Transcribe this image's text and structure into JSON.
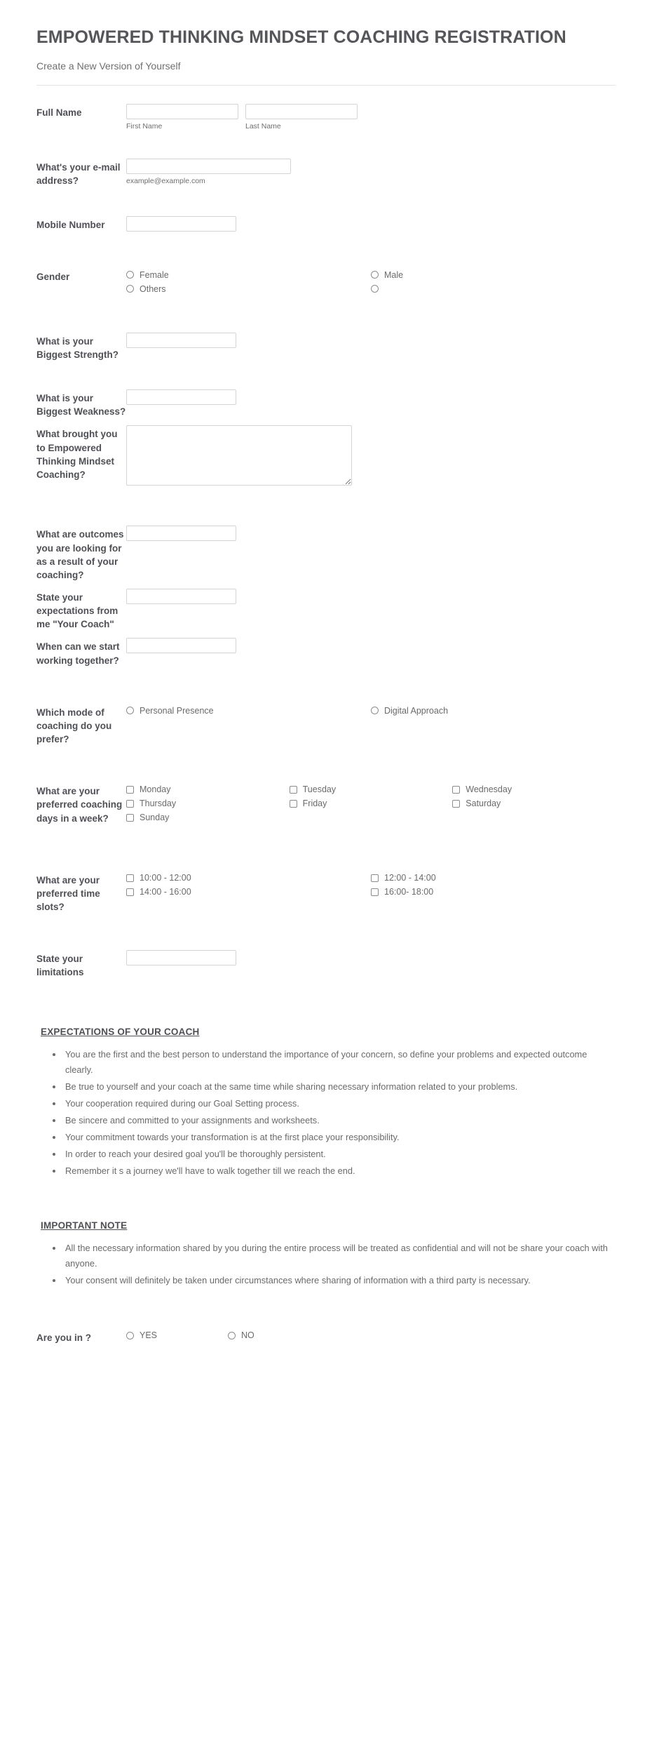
{
  "header": {
    "title": "EMPOWERED THINKING MINDSET COACHING REGISTRATION",
    "subtitle": "Create a New Version of Yourself"
  },
  "fields": {
    "full_name": {
      "label": "Full Name",
      "first_sublabel": "First Name",
      "last_sublabel": "Last Name",
      "first_value": "",
      "last_value": ""
    },
    "email": {
      "label": "What's your e-mail address?",
      "sublabel": "example@example.com",
      "value": ""
    },
    "mobile": {
      "label": "Mobile Number",
      "value": ""
    },
    "gender": {
      "label": "Gender",
      "options": [
        "Female",
        "Male",
        "Others",
        ""
      ]
    },
    "strength": {
      "label": "What is your Biggest Strength?",
      "value": ""
    },
    "weakness": {
      "label": "What is your Biggest Weakness?",
      "value": ""
    },
    "brought_you": {
      "label": "What brought you to Empowered Thinking Mindset Coaching?",
      "value": ""
    },
    "outcomes": {
      "label": "What are outcomes you are looking for as a result of your coaching?",
      "value": ""
    },
    "expectations": {
      "label": "State your expectations from me \"Your Coach\"",
      "value": ""
    },
    "start_when": {
      "label": "When can we start working together?",
      "value": ""
    },
    "mode": {
      "label": "Which mode of coaching do you prefer?",
      "options": [
        "Personal Presence",
        "Digital Approach"
      ]
    },
    "days": {
      "label": "What are your preferred coaching days in a week?",
      "options": [
        "Monday",
        "Tuesday",
        "Wednesday",
        "Thursday",
        "Friday",
        "Saturday",
        "Sunday"
      ]
    },
    "time_slots": {
      "label": "What are your preferred time slots?",
      "options": [
        "10:00 - 12:00",
        "12:00 - 14:00",
        "14:00 - 16:00",
        "16:00- 18:00"
      ]
    },
    "limitations": {
      "label": "State your limitations",
      "value": ""
    },
    "are_you_in": {
      "label": "Are you in ?",
      "options": [
        "YES",
        "NO"
      ]
    }
  },
  "expectations_section": {
    "heading": "EXPECTATIONS OF YOUR COACH",
    "items": [
      " You are the first and the best person to understand the importance of your concern, so define your problems and expected outcome clearly.",
      "Be true to yourself and your coach at the same time while sharing necessary information related to your problems.",
      "Your cooperation required during our Goal Setting process.",
      "Be sincere and committed to your assignments and worksheets.",
      "Your commitment towards your transformation is at the first place your responsibility.",
      "In order to reach your desired goal you'll be thoroughly persistent.",
      "Remember it s a journey we'll have to walk together till we reach the end."
    ]
  },
  "important_note_section": {
    "heading": "IMPORTANT NOTE",
    "items": [
      "All the necessary information shared by you during the entire process will be treated as confidential and will not be share your coach with anyone.",
      "Your consent will definitely be taken under circumstances where sharing of information with a third party is necessary."
    ]
  },
  "colors": {
    "label_text": "#4f5055",
    "body_text": "#6a6a6a",
    "border": "#d4d4d4",
    "divider": "#e4e4e4"
  }
}
